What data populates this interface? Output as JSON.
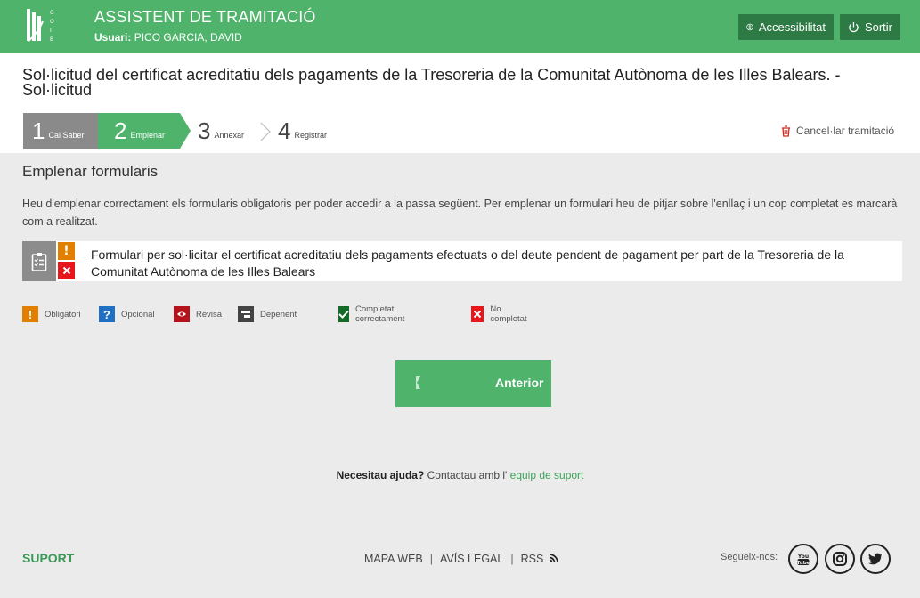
{
  "header": {
    "app_title": "ASSISTENT DE TRAMITACIÓ",
    "user_label": "Usuari:",
    "user_name": "PICO GARCIA, DAVID",
    "accessibility_label": "Accessibilitat",
    "exit_label": "Sortir",
    "brand_color": "#4fb36b",
    "button_color": "#2d7a45"
  },
  "title": "Sol·licitud del certificat acreditatiu dels pagaments de la Tresoreria de la Comunitat Autònoma de les Illes Balears. - Sol·licitud",
  "steps": [
    {
      "num": "1",
      "label": "Cal Saber",
      "state": "done"
    },
    {
      "num": "2",
      "label": "Emplenar",
      "state": "active"
    },
    {
      "num": "3",
      "label": "Annexar",
      "state": "pending"
    },
    {
      "num": "4",
      "label": "Registrar",
      "state": "pending"
    }
  ],
  "cancel_label": "Cancel·lar tramitació",
  "main": {
    "section_title": "Emplenar formularis",
    "intro": "Heu d'emplenar correctament els formularis obligatoris per poder accedir a la passa següent. Per emplenar un formulari heu de pitjar sobre l'enllaç i un cop completat es marcarà com a realitzat.",
    "form": {
      "title": "Formulari per sol·licitar el certificat acreditatiu dels pagaments efectuats o del deute pendent de pagament per part de la Tresoreria de la Comunitat Autònoma de les Illes Balears",
      "status_required": "!",
      "status_completed": "no"
    }
  },
  "legend": [
    {
      "icon": "exclamation-icon",
      "label": "Obligatori",
      "color": "#e07f00"
    },
    {
      "icon": "question-icon",
      "label": "Opcional",
      "color": "#1f6fc2"
    },
    {
      "icon": "eye-icon",
      "label": "Revisa",
      "color": "#b5121b"
    },
    {
      "icon": "dependent-icon",
      "label": "Depenent",
      "color": "#444444"
    },
    {
      "icon": "check-icon",
      "label": "Completat correctament",
      "color": "#136b27"
    },
    {
      "icon": "x-icon",
      "label": "No completat",
      "color": "#e8151b"
    }
  ],
  "prev_button": "Anterior",
  "help": {
    "question": "Necesitau ajuda?",
    "text": "Contactau amb l'",
    "link": "equip de suport"
  },
  "footer": {
    "support": "SUPORT",
    "links": [
      "MAPA WEB",
      "AVÍS LEGAL",
      "RSS"
    ],
    "follow": "Segueix-nos:",
    "social": [
      "youtube-icon",
      "instagram-icon",
      "twitter-icon"
    ]
  }
}
